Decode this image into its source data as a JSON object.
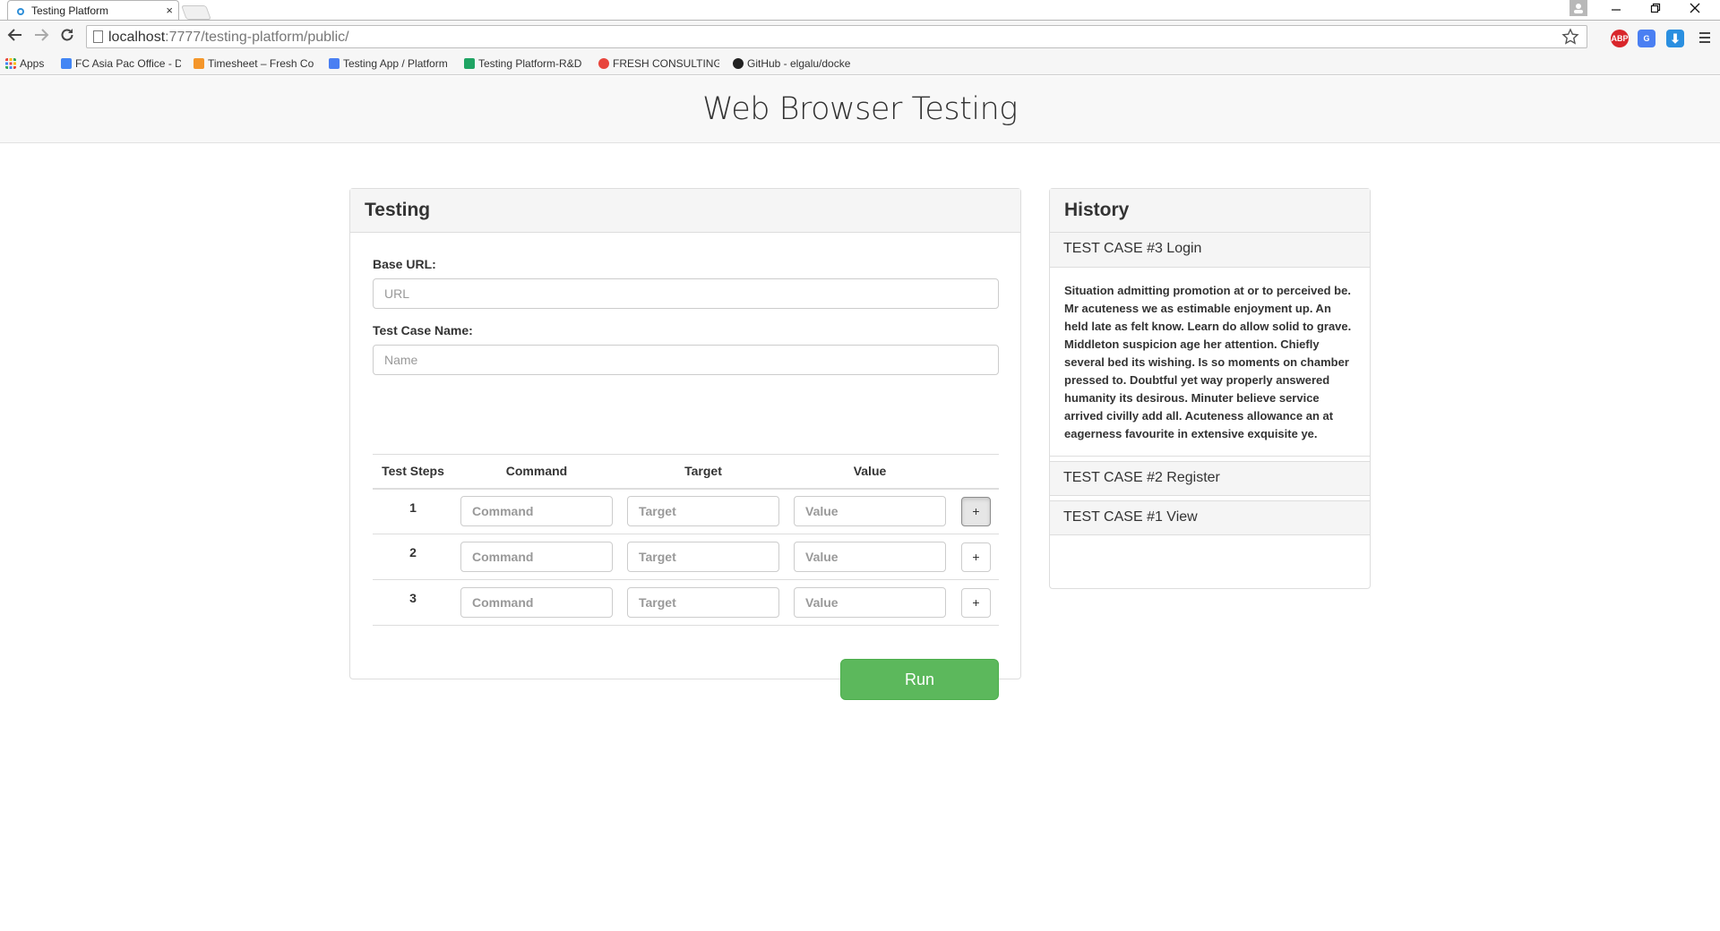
{
  "browser": {
    "tab_title": "Testing Platform",
    "tab_close": "×",
    "url_host": "localhost",
    "url_rest": ":7777/testing-platform/public/",
    "ext_abp": "ABP",
    "ext_translate": "G",
    "ext_download": "⬇",
    "bookmarks": [
      {
        "label": "Apps",
        "color": "#e8453c"
      },
      {
        "label": "FC Asia Pac Office - D",
        "color": "#4285f4"
      },
      {
        "label": "Timesheet – Fresh Co",
        "color": "#f4962a"
      },
      {
        "label": "Testing App / Platform",
        "color": "#4a7ff2"
      },
      {
        "label": "Testing Platform-R&D",
        "color": "#1fa463"
      },
      {
        "label": "FRESH CONSULTING",
        "color": "#e8453c"
      },
      {
        "label": "GitHub - elgalu/docke",
        "color": "#222222"
      }
    ]
  },
  "page": {
    "title": "Web Browser Testing"
  },
  "testing": {
    "heading": "Testing",
    "base_url_label": "Base URL:",
    "base_url_placeholder": "URL",
    "name_label": "Test Case Name:",
    "name_placeholder": "Name",
    "columns": [
      "Test Steps",
      "Command",
      "Target",
      "Value"
    ],
    "steps": [
      {
        "number": "1",
        "command_placeholder": "Command",
        "target_placeholder": "Target",
        "value_placeholder": "Value",
        "add_label": "+"
      },
      {
        "number": "2",
        "command_placeholder": "Command",
        "target_placeholder": "Target",
        "value_placeholder": "Value",
        "add_label": "+"
      },
      {
        "number": "3",
        "command_placeholder": "Command",
        "target_placeholder": "Target",
        "value_placeholder": "Value",
        "add_label": "+"
      }
    ],
    "run_label": "Run"
  },
  "history": {
    "heading": "History",
    "items": [
      {
        "title": "TEST CASE #3 Login",
        "description": "Situation admitting promotion at or to perceived be. Mr acuteness we as estimable enjoyment up. An held late as felt know. Learn do allow solid to grave. Middleton suspicion age her attention. Chiefly several bed its wishing. Is so moments on chamber pressed to. Doubtful yet way properly answered humanity its desirous. Minuter believe service arrived civilly add all. Acuteness allowance an at eagerness favourite in extensive exquisite ye."
      },
      {
        "title": "TEST CASE #2 Register"
      },
      {
        "title": "TEST CASE #1 View"
      }
    ]
  }
}
